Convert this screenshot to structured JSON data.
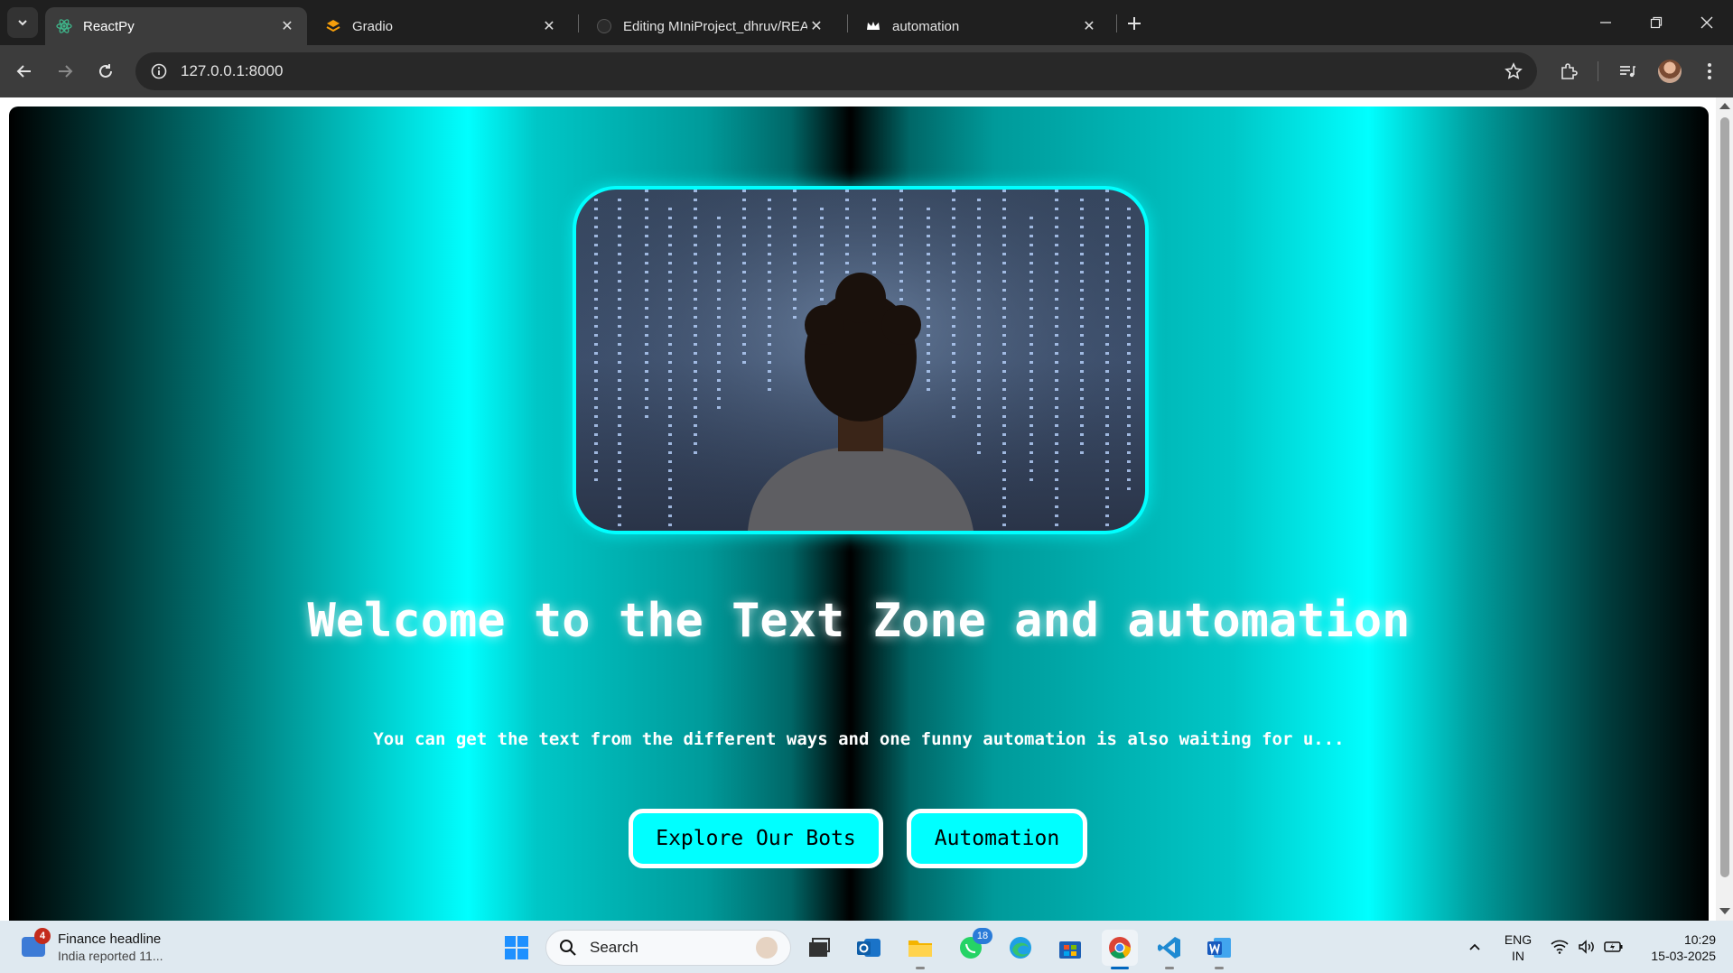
{
  "browser": {
    "tabs": [
      {
        "title": "ReactPy",
        "active": true,
        "icon": "react-icon"
      },
      {
        "title": "Gradio",
        "active": false,
        "icon": "gradio-icon"
      },
      {
        "title": "Editing MIniProject_dhruv/READ",
        "active": false,
        "icon": "github-icon"
      },
      {
        "title": "automation",
        "active": false,
        "icon": "crown-icon"
      }
    ],
    "url": "127.0.0.1:8000"
  },
  "page": {
    "hero_image": "person-looking-at-digital-code",
    "title": "Welcome to the Text Zone and automation",
    "subtitle": "You can get the text from the different ways and one funny automation is also waiting for u...",
    "buttons": {
      "explore": "Explore Our Bots",
      "automation": "Automation"
    },
    "colors": {
      "accent": "#00ffff",
      "background_dark": "#000000"
    }
  },
  "taskbar": {
    "news": {
      "badge": "4",
      "title": "Finance headline",
      "subtitle": "India reported 11..."
    },
    "search_label": "Search",
    "whatsapp_badge": "18",
    "language": {
      "line1": "ENG",
      "line2": "IN"
    },
    "clock": {
      "time": "10:29",
      "date": "15-03-2025"
    }
  }
}
